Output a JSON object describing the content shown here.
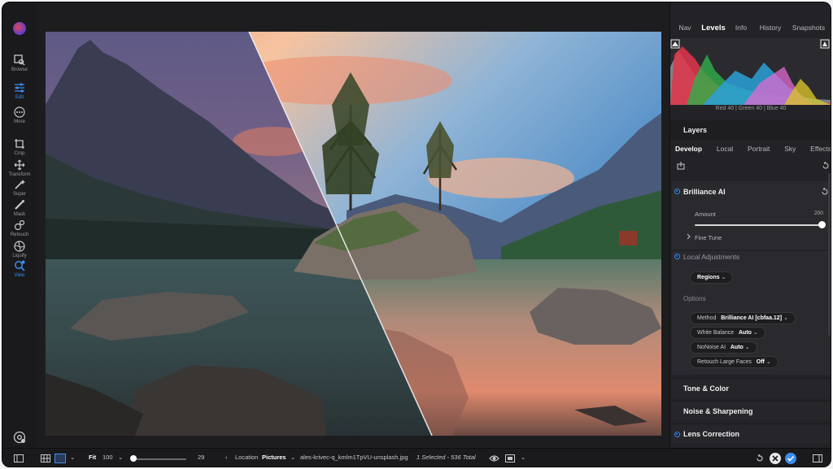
{
  "toolbar": {
    "items": [
      {
        "label": "Browse",
        "icon": "browse-icon"
      },
      {
        "label": "Edit",
        "icon": "edit-sliders-icon"
      },
      {
        "label": "More",
        "icon": "more-icon"
      },
      {
        "label": "Crop",
        "icon": "crop-icon"
      },
      {
        "label": "Transform",
        "icon": "transform-icon"
      },
      {
        "label": "Super",
        "icon": "super-icon"
      },
      {
        "label": "Mask",
        "icon": "mask-icon"
      },
      {
        "label": "Retouch",
        "icon": "retouch-icon"
      },
      {
        "label": "Liquify",
        "icon": "liquify-icon"
      },
      {
        "label": "View",
        "icon": "view-icon"
      }
    ],
    "active": "View"
  },
  "panel": {
    "tabs": [
      "Nav",
      "Levels",
      "Info",
      "History",
      "Snapshots"
    ],
    "active_tab": "Levels",
    "histogram_readout": "Red  40  | Green  40  | Blue  40",
    "layers_title": "Layers",
    "subtabs": [
      "Develop",
      "Local",
      "Portrait",
      "Sky",
      "Effects"
    ],
    "active_subtab": "Develop",
    "brilliance": {
      "title": "Brilliance AI",
      "amount_label": "Amount",
      "amount_value": "200",
      "fine_tune": "Fine Tune"
    },
    "local_adjustments": {
      "title": "Local Adjustments",
      "regions": "Regions"
    },
    "options": {
      "title": "Options",
      "method_label": "Method",
      "method_value": "Brilliance AI [cbfaa.12]",
      "white_balance_label": "White Balance",
      "white_balance_value": "Auto",
      "nonoise_label": "NoNoise AI",
      "nonoise_value": "Auto",
      "retouch_label": "Retouch Large Faces",
      "retouch_value": "Off"
    },
    "sections": [
      "Tone & Color",
      "Noise & Sharpening",
      "Lens Correction"
    ]
  },
  "bottombar": {
    "zoom_mode": "Fit",
    "zoom_value": "100",
    "slider_value": "29",
    "location_label": "Location",
    "location_value": "Pictures",
    "filename": "ales-krivec-q_kmlm1TpVU-unsplash.jpg",
    "selection": "1 Selected - 536 Total"
  },
  "colors": {
    "accent": "#3a8ef0",
    "panel_bg": "#232327",
    "window_bg": "#1d1d20"
  }
}
